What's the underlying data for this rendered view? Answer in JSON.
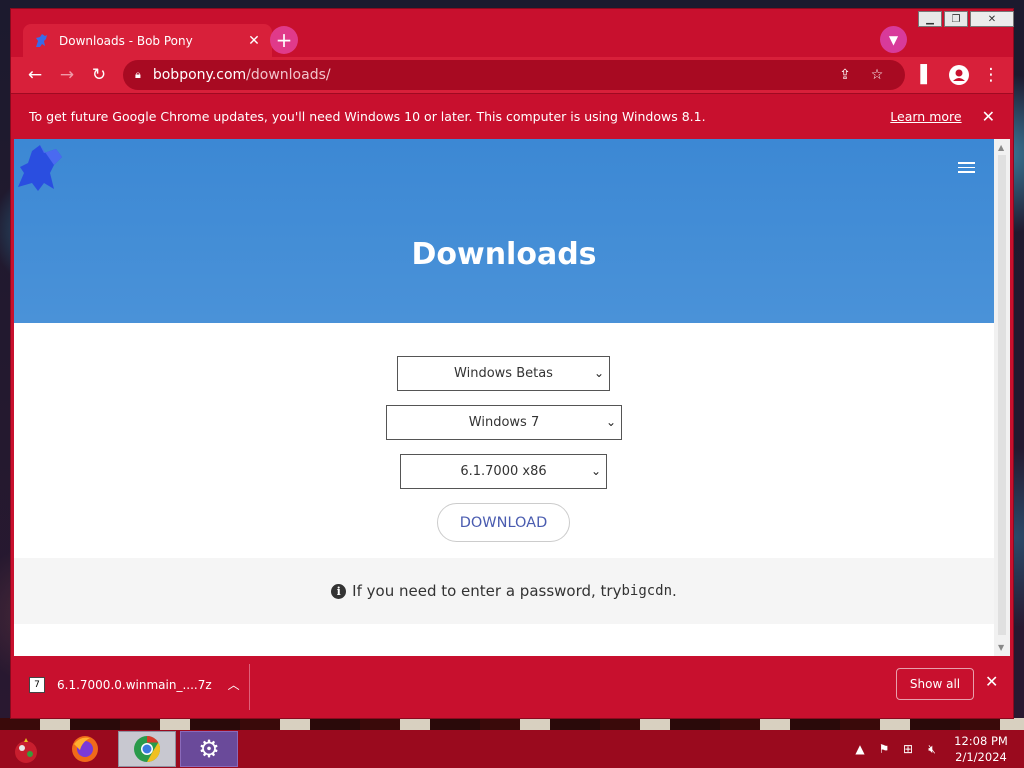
{
  "browser": {
    "tab_title": "Downloads - Bob Pony",
    "new_tab": "+",
    "url_host": "bobpony.com",
    "url_path": "/downloads/"
  },
  "infobar": {
    "message": "To get future Google Chrome updates, you'll need Windows 10 or later. This computer is using Windows 8.1.",
    "learn_more": "Learn more"
  },
  "page": {
    "title": "Downloads",
    "selects": [
      "Windows Betas",
      "Windows 7",
      "6.1.7000 x86"
    ],
    "download_label": "DOWNLOAD",
    "notice_prefix": "If you need to enter a password, try ",
    "notice_code": "bigcdn",
    "notice_suffix": "."
  },
  "shelf": {
    "file_name": "6.1.7000.0.winmain_....7z",
    "show_all": "Show all"
  },
  "taskbar": {
    "time": "12:08 PM",
    "date": "2/1/2024"
  },
  "colors": {
    "chrome_theme": "#c8102e",
    "hero_blue": "#4a92d8",
    "download_text": "#4a5cb0"
  }
}
